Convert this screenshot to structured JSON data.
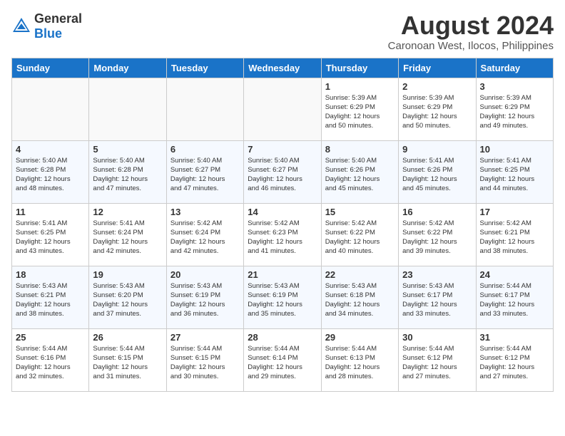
{
  "logo": {
    "text_general": "General",
    "text_blue": "Blue"
  },
  "title": {
    "month_year": "August 2024",
    "location": "Caronoan West, Ilocos, Philippines"
  },
  "weekdays": [
    "Sunday",
    "Monday",
    "Tuesday",
    "Wednesday",
    "Thursday",
    "Friday",
    "Saturday"
  ],
  "weeks": [
    [
      {
        "day": "",
        "info": ""
      },
      {
        "day": "",
        "info": ""
      },
      {
        "day": "",
        "info": ""
      },
      {
        "day": "",
        "info": ""
      },
      {
        "day": "1",
        "info": "Sunrise: 5:39 AM\nSunset: 6:29 PM\nDaylight: 12 hours\nand 50 minutes."
      },
      {
        "day": "2",
        "info": "Sunrise: 5:39 AM\nSunset: 6:29 PM\nDaylight: 12 hours\nand 50 minutes."
      },
      {
        "day": "3",
        "info": "Sunrise: 5:39 AM\nSunset: 6:29 PM\nDaylight: 12 hours\nand 49 minutes."
      }
    ],
    [
      {
        "day": "4",
        "info": "Sunrise: 5:40 AM\nSunset: 6:28 PM\nDaylight: 12 hours\nand 48 minutes."
      },
      {
        "day": "5",
        "info": "Sunrise: 5:40 AM\nSunset: 6:28 PM\nDaylight: 12 hours\nand 47 minutes."
      },
      {
        "day": "6",
        "info": "Sunrise: 5:40 AM\nSunset: 6:27 PM\nDaylight: 12 hours\nand 47 minutes."
      },
      {
        "day": "7",
        "info": "Sunrise: 5:40 AM\nSunset: 6:27 PM\nDaylight: 12 hours\nand 46 minutes."
      },
      {
        "day": "8",
        "info": "Sunrise: 5:40 AM\nSunset: 6:26 PM\nDaylight: 12 hours\nand 45 minutes."
      },
      {
        "day": "9",
        "info": "Sunrise: 5:41 AM\nSunset: 6:26 PM\nDaylight: 12 hours\nand 45 minutes."
      },
      {
        "day": "10",
        "info": "Sunrise: 5:41 AM\nSunset: 6:25 PM\nDaylight: 12 hours\nand 44 minutes."
      }
    ],
    [
      {
        "day": "11",
        "info": "Sunrise: 5:41 AM\nSunset: 6:25 PM\nDaylight: 12 hours\nand 43 minutes."
      },
      {
        "day": "12",
        "info": "Sunrise: 5:41 AM\nSunset: 6:24 PM\nDaylight: 12 hours\nand 42 minutes."
      },
      {
        "day": "13",
        "info": "Sunrise: 5:42 AM\nSunset: 6:24 PM\nDaylight: 12 hours\nand 42 minutes."
      },
      {
        "day": "14",
        "info": "Sunrise: 5:42 AM\nSunset: 6:23 PM\nDaylight: 12 hours\nand 41 minutes."
      },
      {
        "day": "15",
        "info": "Sunrise: 5:42 AM\nSunset: 6:22 PM\nDaylight: 12 hours\nand 40 minutes."
      },
      {
        "day": "16",
        "info": "Sunrise: 5:42 AM\nSunset: 6:22 PM\nDaylight: 12 hours\nand 39 minutes."
      },
      {
        "day": "17",
        "info": "Sunrise: 5:42 AM\nSunset: 6:21 PM\nDaylight: 12 hours\nand 38 minutes."
      }
    ],
    [
      {
        "day": "18",
        "info": "Sunrise: 5:43 AM\nSunset: 6:21 PM\nDaylight: 12 hours\nand 38 minutes."
      },
      {
        "day": "19",
        "info": "Sunrise: 5:43 AM\nSunset: 6:20 PM\nDaylight: 12 hours\nand 37 minutes."
      },
      {
        "day": "20",
        "info": "Sunrise: 5:43 AM\nSunset: 6:19 PM\nDaylight: 12 hours\nand 36 minutes."
      },
      {
        "day": "21",
        "info": "Sunrise: 5:43 AM\nSunset: 6:19 PM\nDaylight: 12 hours\nand 35 minutes."
      },
      {
        "day": "22",
        "info": "Sunrise: 5:43 AM\nSunset: 6:18 PM\nDaylight: 12 hours\nand 34 minutes."
      },
      {
        "day": "23",
        "info": "Sunrise: 5:43 AM\nSunset: 6:17 PM\nDaylight: 12 hours\nand 33 minutes."
      },
      {
        "day": "24",
        "info": "Sunrise: 5:44 AM\nSunset: 6:17 PM\nDaylight: 12 hours\nand 33 minutes."
      }
    ],
    [
      {
        "day": "25",
        "info": "Sunrise: 5:44 AM\nSunset: 6:16 PM\nDaylight: 12 hours\nand 32 minutes."
      },
      {
        "day": "26",
        "info": "Sunrise: 5:44 AM\nSunset: 6:15 PM\nDaylight: 12 hours\nand 31 minutes."
      },
      {
        "day": "27",
        "info": "Sunrise: 5:44 AM\nSunset: 6:15 PM\nDaylight: 12 hours\nand 30 minutes."
      },
      {
        "day": "28",
        "info": "Sunrise: 5:44 AM\nSunset: 6:14 PM\nDaylight: 12 hours\nand 29 minutes."
      },
      {
        "day": "29",
        "info": "Sunrise: 5:44 AM\nSunset: 6:13 PM\nDaylight: 12 hours\nand 28 minutes."
      },
      {
        "day": "30",
        "info": "Sunrise: 5:44 AM\nSunset: 6:12 PM\nDaylight: 12 hours\nand 27 minutes."
      },
      {
        "day": "31",
        "info": "Sunrise: 5:44 AM\nSunset: 6:12 PM\nDaylight: 12 hours\nand 27 minutes."
      }
    ]
  ]
}
